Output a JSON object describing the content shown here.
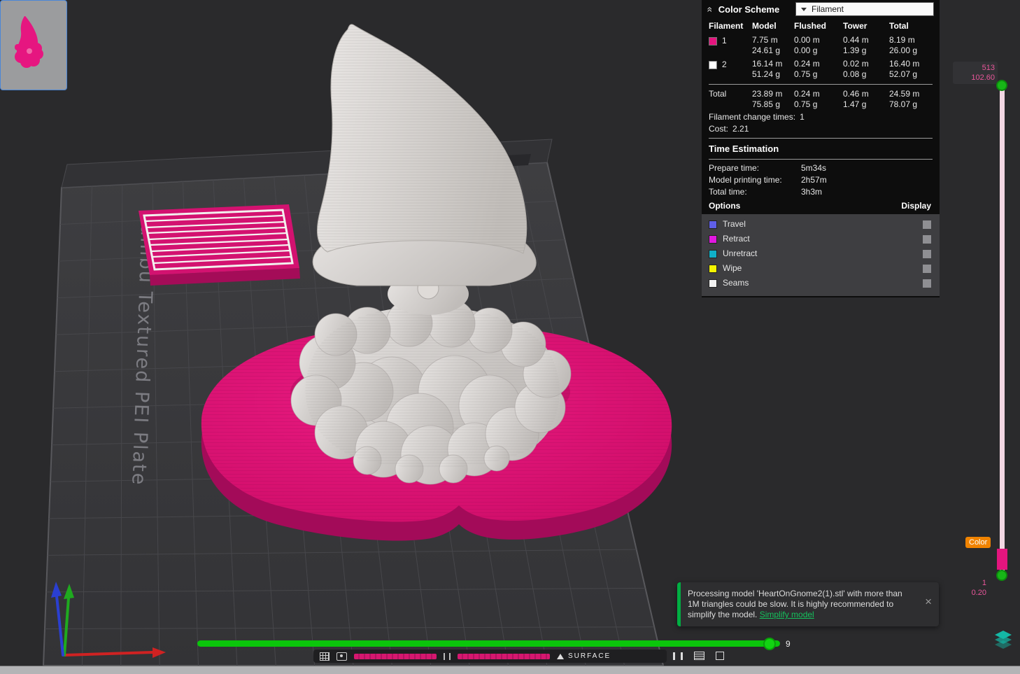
{
  "icons": {
    "collapse": "«",
    "close": "×"
  },
  "color_scheme_panel": {
    "title": "Color Scheme",
    "dropdown_value": "Filament",
    "table": {
      "headers": [
        "Filament",
        "Model",
        "Flushed",
        "Tower",
        "Total"
      ],
      "rows": [
        {
          "id": "1",
          "color": "#e4157e",
          "model_m": "7.75 m",
          "model_g": "24.61 g",
          "flushed_m": "0.00 m",
          "flushed_g": "0.00 g",
          "tower_m": "0.44 m",
          "tower_g": "1.39 g",
          "total_m": "8.19 m",
          "total_g": "26.00 g"
        },
        {
          "id": "2",
          "color": "#ffffff",
          "model_m": "16.14 m",
          "model_g": "51.24 g",
          "flushed_m": "0.24 m",
          "flushed_g": "0.75 g",
          "tower_m": "0.02 m",
          "tower_g": "0.08 g",
          "total_m": "16.40 m",
          "total_g": "52.07 g"
        }
      ],
      "total": {
        "label": "Total",
        "model_m": "23.89 m",
        "model_g": "75.85 g",
        "flushed_m": "0.24 m",
        "flushed_g": "0.75 g",
        "tower_m": "0.46 m",
        "tower_g": "1.47 g",
        "total_m": "24.59 m",
        "total_g": "78.07 g"
      }
    },
    "filament_change": {
      "label": "Filament change times:",
      "value": "1"
    },
    "cost": {
      "label": "Cost:",
      "value": "2.21"
    },
    "time_estimation": {
      "title": "Time Estimation",
      "rows": [
        {
          "label": "Prepare time:",
          "value": "5m34s"
        },
        {
          "label": "Model printing time:",
          "value": "2h57m"
        },
        {
          "label": "Total time:",
          "value": "3h3m"
        }
      ]
    },
    "options": {
      "title": "Options",
      "display_label": "Display",
      "items": [
        {
          "label": "Travel",
          "color": "#5f5fe8"
        },
        {
          "label": "Retract",
          "color": "#e118e1"
        },
        {
          "label": "Unretract",
          "color": "#10b0c8"
        },
        {
          "label": "Wipe",
          "color": "#f5f500"
        },
        {
          "label": "Seams",
          "color": "#f2f2f2"
        }
      ]
    }
  },
  "layer_slider": {
    "top_layer": "513",
    "top_height": "102.60",
    "bottom_layer": "1",
    "bottom_height": "0.20",
    "color_tag": "Color",
    "current_color": "#e4157e"
  },
  "step_slider": {
    "label": "9"
  },
  "legend": {
    "surface": "SURFACE"
  },
  "toast": {
    "message": "Processing model 'HeartOnGnome2(1).stl' with more than 1M triangles could be slow. It is highly recommended to simplify the model. ",
    "link_label": "Simplify model"
  },
  "plate": {
    "label": "Bambu Textured PEI Plate"
  }
}
